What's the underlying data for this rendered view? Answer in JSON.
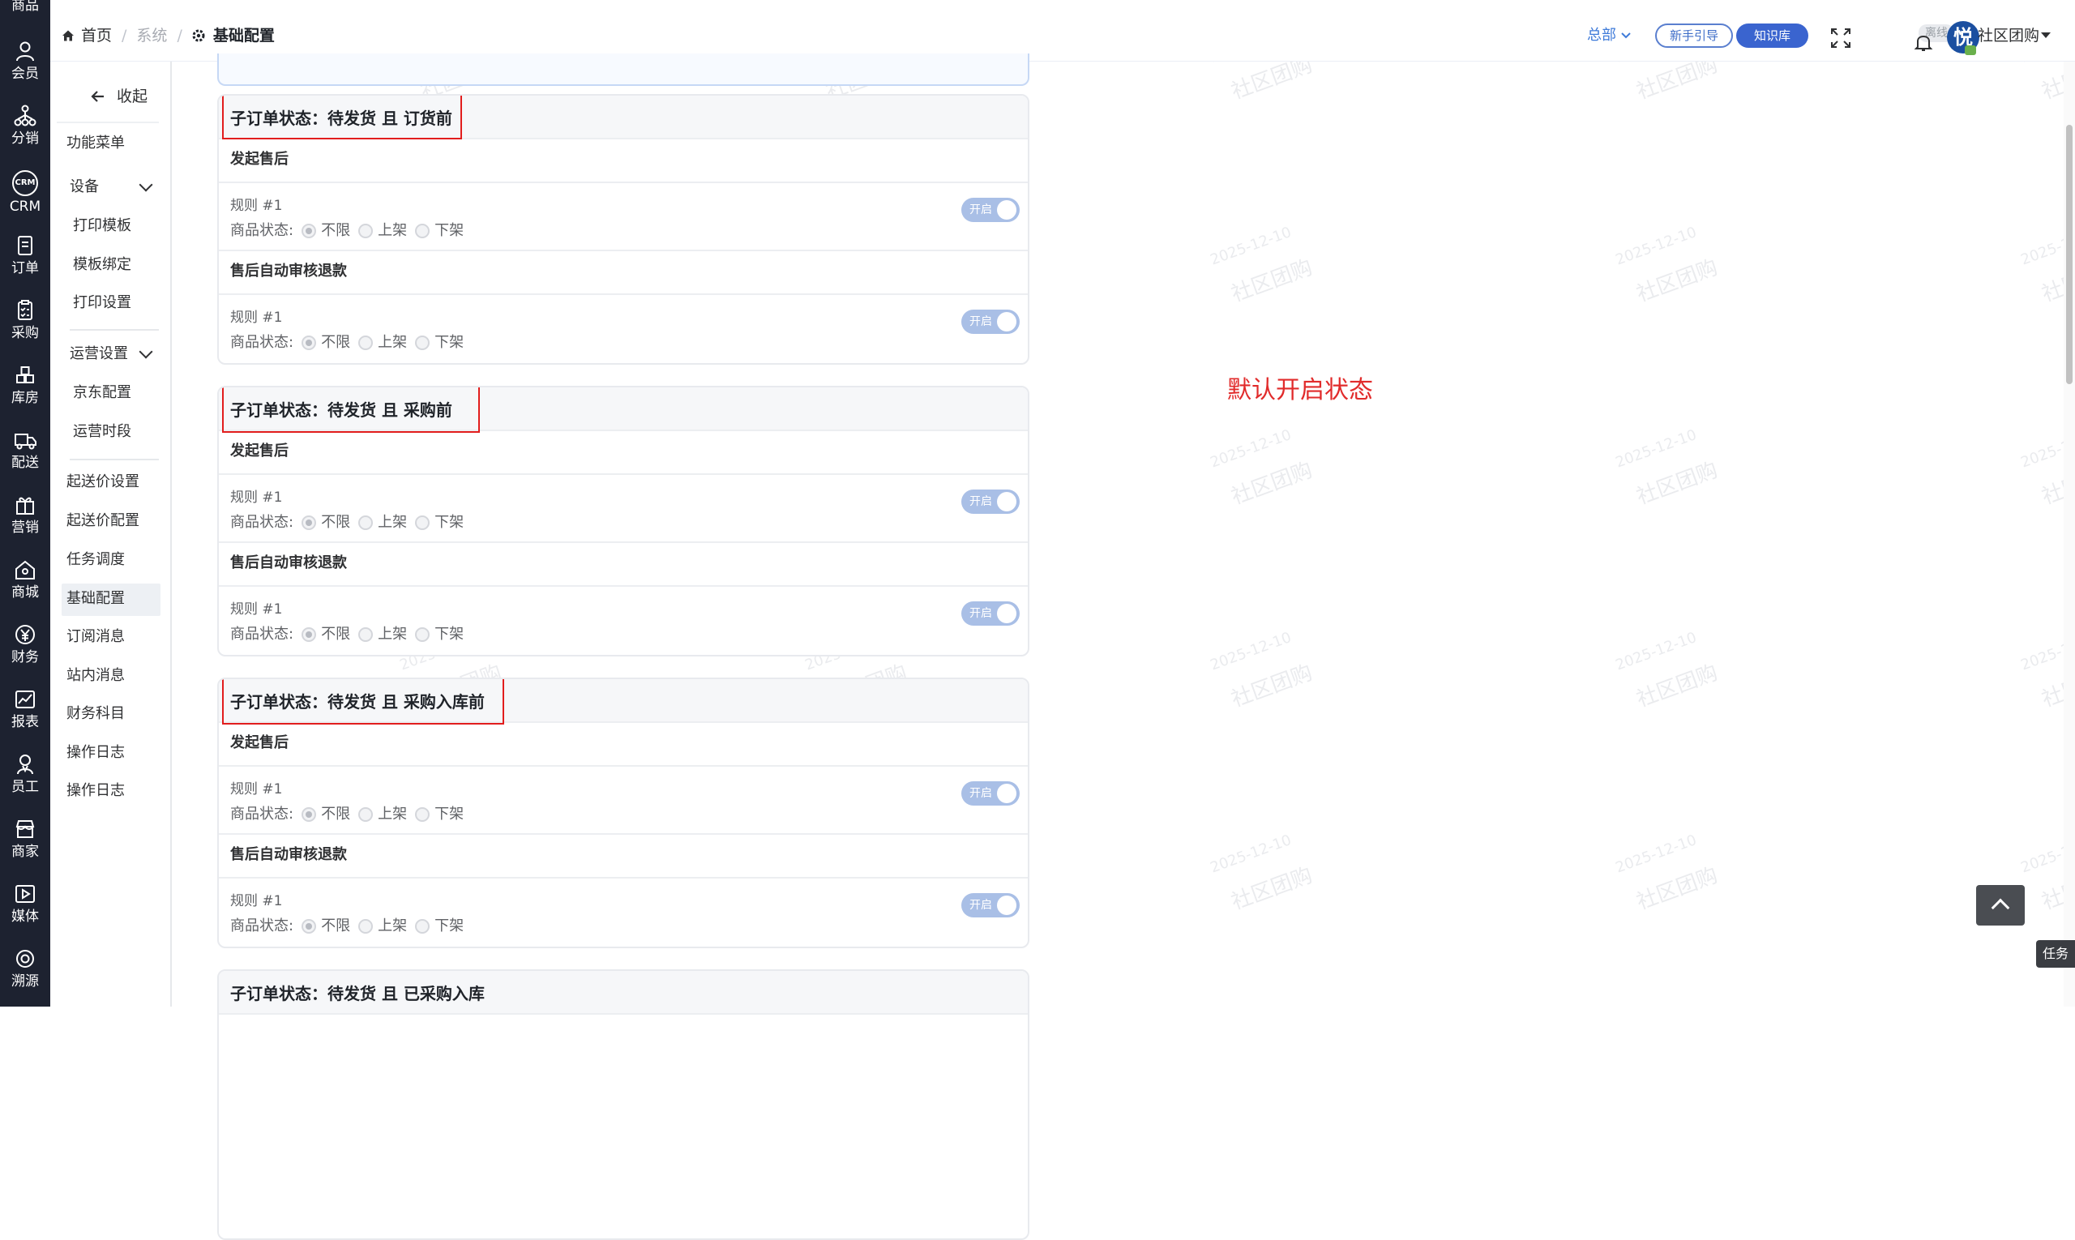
{
  "icon_nav": [
    {
      "label": "商品",
      "icon": "goods-icon"
    },
    {
      "label": "会员",
      "icon": "user-icon"
    },
    {
      "label": "分销",
      "icon": "distribution-icon"
    },
    {
      "label": "CRM",
      "icon": "crm-icon"
    },
    {
      "label": "订单",
      "icon": "order-icon"
    },
    {
      "label": "采购",
      "icon": "purchase-icon"
    },
    {
      "label": "库房",
      "icon": "warehouse-icon"
    },
    {
      "label": "配送",
      "icon": "delivery-icon"
    },
    {
      "label": "营销",
      "icon": "gift-icon"
    },
    {
      "label": "商城",
      "icon": "shop-icon"
    },
    {
      "label": "财务",
      "icon": "yuan-icon"
    },
    {
      "label": "报表",
      "icon": "chart-icon"
    },
    {
      "label": "员工",
      "icon": "staff-icon"
    },
    {
      "label": "商家",
      "icon": "store-icon"
    },
    {
      "label": "媒体",
      "icon": "media-icon"
    },
    {
      "label": "溯源",
      "icon": "trace-icon"
    }
  ],
  "breadcrumb": {
    "home": "首页",
    "system": "系统",
    "current": "基础配置"
  },
  "header": {
    "org": "总部",
    "guide_button": "新手引导",
    "knowledge_button": "知识库",
    "status": "离线",
    "avatar_char": "悦",
    "user": "社区团购"
  },
  "sidebar": {
    "collapse": "收起",
    "menu_title": "功能菜单",
    "group_device": "设备",
    "device_items": [
      "打印模板",
      "模板绑定",
      "打印设置"
    ],
    "group_ops": "运营设置",
    "ops_items": [
      "京东配置",
      "运营时段"
    ],
    "items": [
      "起送价设置",
      "起送价配置",
      "任务调度",
      "基础配置",
      "订阅消息",
      "站内消息",
      "财务科目",
      "操作日志",
      "操作日志"
    ]
  },
  "cards": [
    {
      "title": "子订单状态：待发货 且 订货前",
      "sections": [
        {
          "title": "发起售后",
          "rule": "规则 #1",
          "status_label": "商品状态:",
          "options": [
            "不限",
            "上架",
            "下架"
          ],
          "toggle": "开启"
        },
        {
          "title": "售后自动审核退款",
          "rule": "规则 #1",
          "status_label": "商品状态:",
          "options": [
            "不限",
            "上架",
            "下架"
          ],
          "toggle": "开启"
        }
      ]
    },
    {
      "title": "子订单状态：待发货 且 采购前",
      "sections": [
        {
          "title": "发起售后",
          "rule": "规则 #1",
          "status_label": "商品状态:",
          "options": [
            "不限",
            "上架",
            "下架"
          ],
          "toggle": "开启"
        },
        {
          "title": "售后自动审核退款",
          "rule": "规则 #1",
          "status_label": "商品状态:",
          "options": [
            "不限",
            "上架",
            "下架"
          ],
          "toggle": "开启"
        }
      ]
    },
    {
      "title": "子订单状态：待发货 且 采购入库前",
      "sections": [
        {
          "title": "发起售后",
          "rule": "规则 #1",
          "status_label": "商品状态:",
          "options": [
            "不限",
            "上架",
            "下架"
          ],
          "toggle": "开启"
        },
        {
          "title": "售后自动审核退款",
          "rule": "规则 #1",
          "status_label": "商品状态:",
          "options": [
            "不限",
            "上架",
            "下架"
          ],
          "toggle": "开启"
        }
      ]
    },
    {
      "title": "子订单状态：待发货 且 已采购入库",
      "sections": []
    }
  ],
  "annotation": "默认开启状态",
  "task_tab": "任务",
  "watermark": {
    "date": "2025-12-10",
    "text": "社区团购"
  },
  "colors": {
    "nav_bg": "#1d2230",
    "accent": "#3a64cf",
    "highlight_border": "#e21d1d",
    "annotation": "#e12b2b"
  }
}
